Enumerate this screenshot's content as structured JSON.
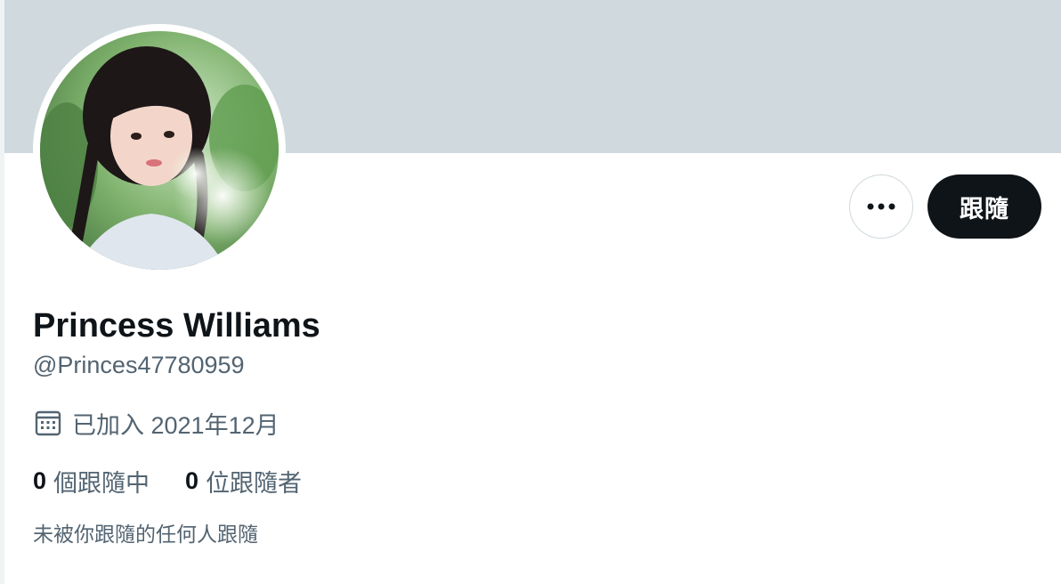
{
  "profile": {
    "display_name": "Princess Williams",
    "handle": "@Princes47780959",
    "joined": "已加入 2021年12月",
    "following_count": "0",
    "following_label": "個跟隨中",
    "followers_count": "0",
    "followers_label": "位跟隨者",
    "not_followed_note": "未被你跟隨的任何人跟隨"
  },
  "actions": {
    "follow_label": "跟隨",
    "more_icon": "more-dots-icon"
  },
  "icons": {
    "joined_icon": "calendar-icon"
  },
  "colors": {
    "banner": "#cfd9de",
    "primary_text": "#0f1419",
    "secondary_text": "#536471",
    "follow_button_bg": "#0f1419",
    "border": "#cfd9de"
  }
}
